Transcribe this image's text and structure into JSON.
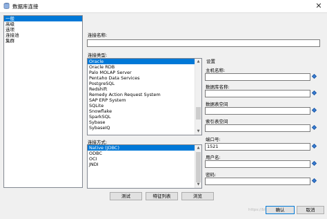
{
  "window": {
    "title": "数据库连接",
    "close_glyph": "✕"
  },
  "nav": {
    "items": [
      "一般",
      "高级",
      "选项",
      "连接池",
      "集群"
    ],
    "selected_index": 0
  },
  "form": {
    "connection_name_label": "连接名称:",
    "connection_name_value": "",
    "connection_type_label": "连接类型:",
    "connection_types": [
      "Oracle",
      "Oracle RDB",
      "Palo MOLAP Server",
      "Pentaho Data Services",
      "PostgreSQL",
      "Redshift",
      "Remedy Action Request System",
      "SAP ERP System",
      "SQLite",
      "Snowflake",
      "SparkSQL",
      "Sybase",
      "SybaseIQ"
    ],
    "connection_type_selected": "Oracle",
    "access_method_label": "连接方式:",
    "access_methods": [
      "Native (JDBC)",
      "ODBC",
      "OCI",
      "JNDI"
    ],
    "access_method_selected": "Native (JDBC)"
  },
  "settings": {
    "header": "设置",
    "fields": [
      {
        "label": "主机名称:",
        "value": ""
      },
      {
        "label": "数据库名称:",
        "value": ""
      },
      {
        "label": "数据表空间",
        "value": ""
      },
      {
        "label": "索引表空间",
        "value": ""
      },
      {
        "label": "端口号:",
        "value": "1521"
      },
      {
        "label": "用户名:",
        "value": ""
      },
      {
        "label": "密码:",
        "value": ""
      }
    ]
  },
  "buttons": {
    "test": "测试",
    "features": "特征列表",
    "explore": "浏览",
    "ok": "确认",
    "cancel": "取消"
  },
  "colors": {
    "selection": "#0078d7",
    "variable_icon": "#3b7fd4"
  },
  "watermark": "https://blog.csdn.net/..."
}
